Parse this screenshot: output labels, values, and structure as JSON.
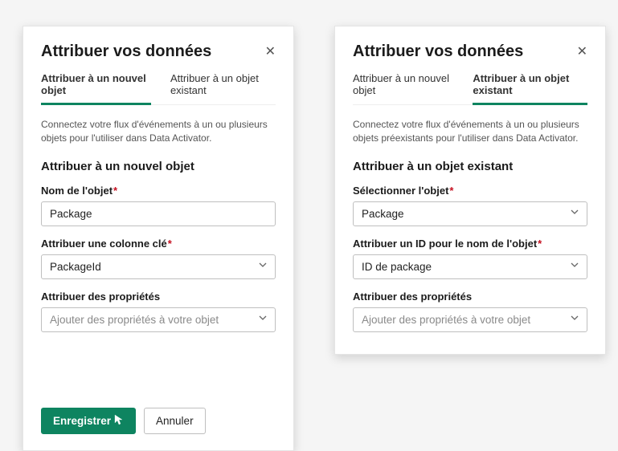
{
  "left": {
    "title": "Attribuer vos données",
    "tabs": {
      "new": "Attribuer à un nouvel objet",
      "existing": "Attribuer à un objet existant"
    },
    "description": "Connectez votre flux d'événements à un ou plusieurs objets pour l'utiliser dans Data Activator.",
    "section": "Attribuer à un nouvel objet",
    "fields": {
      "name_label": "Nom de l'objet",
      "name_value": "Package",
      "keycol_label": "Attribuer une colonne clé",
      "keycol_value": "PackageId",
      "props_label": "Attribuer des propriétés",
      "props_placeholder": "Ajouter des propriétés à votre objet"
    },
    "buttons": {
      "save": "Enregistrer",
      "cancel": "Annuler"
    }
  },
  "right": {
    "title": "Attribuer vos données",
    "tabs": {
      "new": "Attribuer à un nouvel objet",
      "existing": "Attribuer à un objet existant"
    },
    "description": "Connectez votre flux d'événements à un ou plusieurs objets préexistants pour l'utiliser dans Data Activator.",
    "section": "Attribuer à un objet existant",
    "fields": {
      "select_label": "Sélectionner l'objet",
      "select_value": "Package",
      "id_label": "Attribuer un ID pour le nom de l'objet",
      "id_value": "ID de package",
      "props_label": "Attribuer des propriétés",
      "props_placeholder": "Ajouter des propriétés à votre objet"
    }
  }
}
